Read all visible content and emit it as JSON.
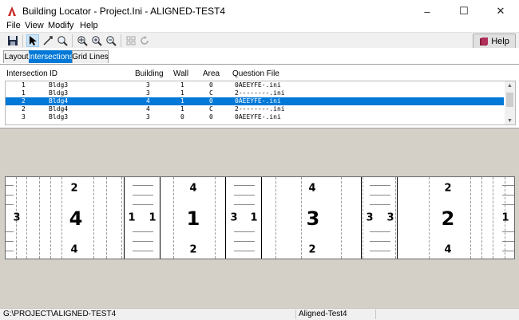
{
  "window": {
    "title": "Building Locator - Project.Ini - ALIGNED-TEST4",
    "controls": [
      "–",
      "☐",
      "✕"
    ]
  },
  "menu": [
    "File",
    "View",
    "Modify",
    "Help"
  ],
  "toolbar": {
    "help_label": "Help"
  },
  "tabs": [
    {
      "label": "Layout",
      "active": false
    },
    {
      "label": "Intersections",
      "active": true
    },
    {
      "label": "Grid Lines",
      "active": false
    }
  ],
  "list": {
    "columns": [
      "Intersection",
      "ID",
      "Building",
      "Wall",
      "Area",
      "Question File"
    ],
    "rows": [
      {
        "intersection": "1",
        "id": "Bldg3",
        "building": "3",
        "wall": "1",
        "area": "0",
        "qfile": "0AEEYFE-.ini",
        "selected": false
      },
      {
        "intersection": "1",
        "id": "Bldg3",
        "building": "3",
        "wall": "1",
        "area": "C",
        "qfile": "2--------.ini",
        "selected": false
      },
      {
        "intersection": "2",
        "id": "Bldg4",
        "building": "4",
        "wall": "1",
        "area": "0",
        "qfile": "0AEEYFE-.ini",
        "selected": true
      },
      {
        "intersection": "2",
        "id": "Bldg4",
        "building": "4",
        "wall": "1",
        "area": "C",
        "qfile": "2--------.ini",
        "selected": false
      },
      {
        "intersection": "3",
        "id": "Bldg3",
        "building": "3",
        "wall": "0",
        "area": "0",
        "qfile": "0AEEYFE-.ini",
        "selected": false
      }
    ]
  },
  "strip": {
    "labels": [
      "3",
      "2",
      "4",
      "4",
      "1",
      "1",
      "4",
      "1",
      "2",
      "3",
      "1",
      "4",
      "3",
      "2",
      "3",
      "3",
      "2",
      "2",
      "4",
      "1"
    ]
  },
  "status": {
    "path": "G:\\PROJECT\\ALIGNED-TEST4",
    "name": "Aligned-Test4"
  }
}
